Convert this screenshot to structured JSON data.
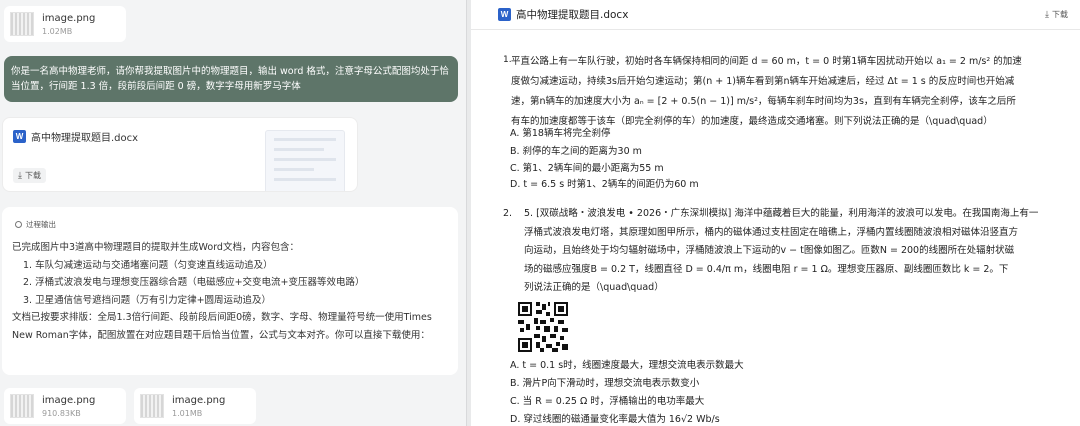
{
  "left": {
    "top_file": {
      "name": "image.png",
      "size": "1.02MB"
    },
    "prompt": "你是一名高中物理老师，请你帮我提取图片中的物理题目，输出 word 格式，注意字母公式配图均处于恰当位置，行间距 1.3 倍，段前段后间距 0 磅，数字字母用新罗马字体",
    "doc_card": {
      "name": "高中物理提取题目.docx",
      "download_label": "下载"
    },
    "reasoning_label": "过程输出",
    "reply": {
      "intro": "已完成图片中3道高中物理题目的提取并生成Word文档，内容包含：",
      "items": [
        "1. 车队匀减速运动与交通堵塞问题（匀变速直线运动追及）",
        "2. 浮桶式波浪发电与理想变压器综合题（电磁感应+交变电流+变压器等效电路）",
        "3. 卫星通信信号遮挡问题（万有引力定律+圆周运动追及）"
      ],
      "outro": "文档已按要求排版：全局1.3倍行间距、段前段后间距0磅，数字、字母、物理量符号统一使用Times New Roman字体，配图放置在对应题目题干后恰当位置，公式与文本对齐。你可以直接下载使用："
    },
    "bottom_files": [
      {
        "name": "image.png",
        "size": "910.83KB"
      },
      {
        "name": "image.png",
        "size": "1.01MB"
      }
    ]
  },
  "right": {
    "title": "高中物理提取题目.docx",
    "download_label": "下载",
    "q1": {
      "number": "1.",
      "lines": [
        "平直公路上有一车队行驶，初始时各车辆保持相同的间距 d = 60 m，t = 0 时第1辆车因扰动开始以 a₁ = 2 m/s² 的加速",
        "度做匀减速运动，持续3s后开始匀速运动；第(n + 1)辆车看到第n辆车开始减速后，经过 Δt = 1 s 的反应时间也开始减",
        "速，第n辆车的加速度大小为 aₙ = [2 + 0.5(n − 1)] m/s²，每辆车刹车时间均为3s，直到有车辆完全刹停，该车之后所",
        "有车的加速度都等于该车（即完全刹停的车）的加速度，最终造成交通堵塞。则下列说法正确的是（\\quad\\quad）"
      ],
      "options": [
        "A. 第18辆车将完全刹停",
        "B. 刹停的车之间的距离为30 m",
        "C. 第1、2辆车间的最小距离为55 m",
        "D. t = 6.5 s 时第1、2辆车的间距仍为60 m"
      ]
    },
    "q2": {
      "number": "2.",
      "lines": [
        "5. [双碳战略・波浪发电 • 2026・广东深圳模拟] 海洋中蕴藏着巨大的能量，利用海洋的波浪可以发电。在我国南海上有一",
        "浮桶式波浪发电灯塔，其原理如图甲所示，桶内的磁体通过支柱固定在暗礁上，浮桶内置线圈随波浪相对磁体沿竖直方",
        "向运动，且始终处于均匀辐射磁场中，浮桶随波浪上下运动的v − t图像如图乙。匝数N = 200的线圈所在处辐射状磁",
        "场的磁感应强度B = 0.2 T，线圈直径 D = 0.4/π m，线圈电阻 r = 1 Ω。理想变压器原、副线圈匝数比 k = 2。下",
        "列说法正确的是（\\quad\\quad）"
      ],
      "options": [
        "A. t = 0.1 s时，线圈速度最大，理想交流电表示数最大",
        "B. 滑片P向下滑动时，理想交流电表示数变小",
        "C. 当 R = 0.25 Ω 时，浮桶输出的电功率最大",
        "D. 穿过线圈的磁通量变化率最大值为 16√2 Wb/s"
      ]
    }
  }
}
